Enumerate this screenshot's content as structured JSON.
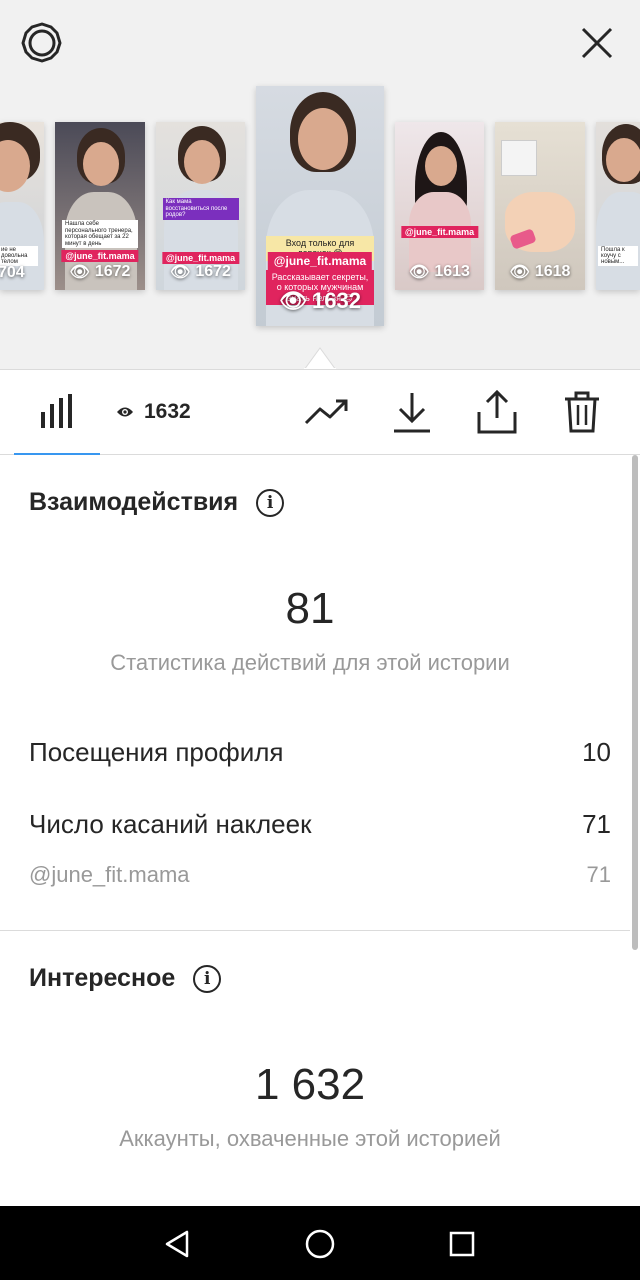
{
  "header": {
    "settings_icon": "gear-icon",
    "close_icon": "close-icon"
  },
  "stories": [
    {
      "views": "704",
      "tag": "",
      "caption": "ие не довольна телом"
    },
    {
      "views": "1672",
      "tag": "@june_fit.mama",
      "caption": "Нашла себе персонального тренера, которая обещает за 22 минут в день"
    },
    {
      "views": "1672",
      "tag": "@june_fit.mama",
      "caption": "Как мама восстановиться после родов?"
    },
    {
      "views": "1632",
      "tag": "@june_fit.mama",
      "caption_top": "Вход только для девочек 😊",
      "caption": "Рассказывает секреты, о которых мужчинам знать нельзя 😊"
    },
    {
      "views": "1613",
      "tag": "@june_fit.mama",
      "caption": ""
    },
    {
      "views": "1618",
      "tag": "",
      "caption": ""
    },
    {
      "views": "",
      "tag": "",
      "caption": "Пошла к коучу с новым..."
    }
  ],
  "toolbar": {
    "views": "1632",
    "insights_icon": "bar-chart-icon",
    "views_icon": "eye-icon",
    "actions": [
      "trend-icon",
      "download-icon",
      "share-icon",
      "trash-icon"
    ]
  },
  "interactions": {
    "title": "Взаимодействия",
    "total": "81",
    "subtitle": "Статистика действий для этой истории",
    "rows": [
      {
        "label": "Посещения профиля",
        "value": "10"
      },
      {
        "label": "Число касаний наклеек",
        "value": "71"
      }
    ],
    "sticker": {
      "label": "@june_fit.mama",
      "value": "71"
    }
  },
  "discovery": {
    "title": "Интересное",
    "total": "1 632",
    "subtitle": "Аккаунты, охваченные этой историей"
  },
  "colors": {
    "accent": "#3897f0",
    "tag": "#e0245e",
    "muted": "#999999"
  },
  "android_nav": [
    "back-icon",
    "home-icon",
    "recents-icon"
  ]
}
